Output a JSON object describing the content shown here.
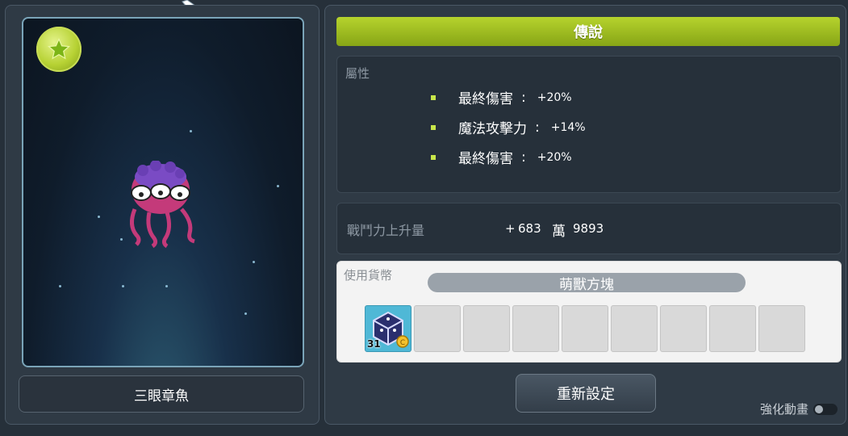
{
  "pet": {
    "name": "三眼章魚",
    "badge_icon": "star-icon"
  },
  "rank": {
    "label": "傳說",
    "color": "#a4c224"
  },
  "attributes": {
    "label": "屬性",
    "items": [
      {
        "name": "最終傷害",
        "sep": ":",
        "value": "+20%"
      },
      {
        "name": "魔法攻擊力",
        "sep": ":",
        "value": "+14%"
      },
      {
        "name": "最終傷害",
        "sep": ":",
        "value": "+20%"
      }
    ]
  },
  "combat_power": {
    "label": "戰鬥力上升量",
    "plus": "+",
    "value_1": "683",
    "unit": "萬",
    "value_2": "9893"
  },
  "currency": {
    "label": "使用貨幣",
    "name": "萌獸方塊",
    "slots": [
      {
        "filled": true,
        "count": "31",
        "icon": "cube-icon"
      },
      {
        "filled": false
      },
      {
        "filled": false
      },
      {
        "filled": false
      },
      {
        "filled": false
      },
      {
        "filled": false
      },
      {
        "filled": false
      },
      {
        "filled": false
      },
      {
        "filled": false
      }
    ]
  },
  "reset_button": "重新設定",
  "animation_toggle": {
    "label": "強化動畫",
    "on": false
  }
}
